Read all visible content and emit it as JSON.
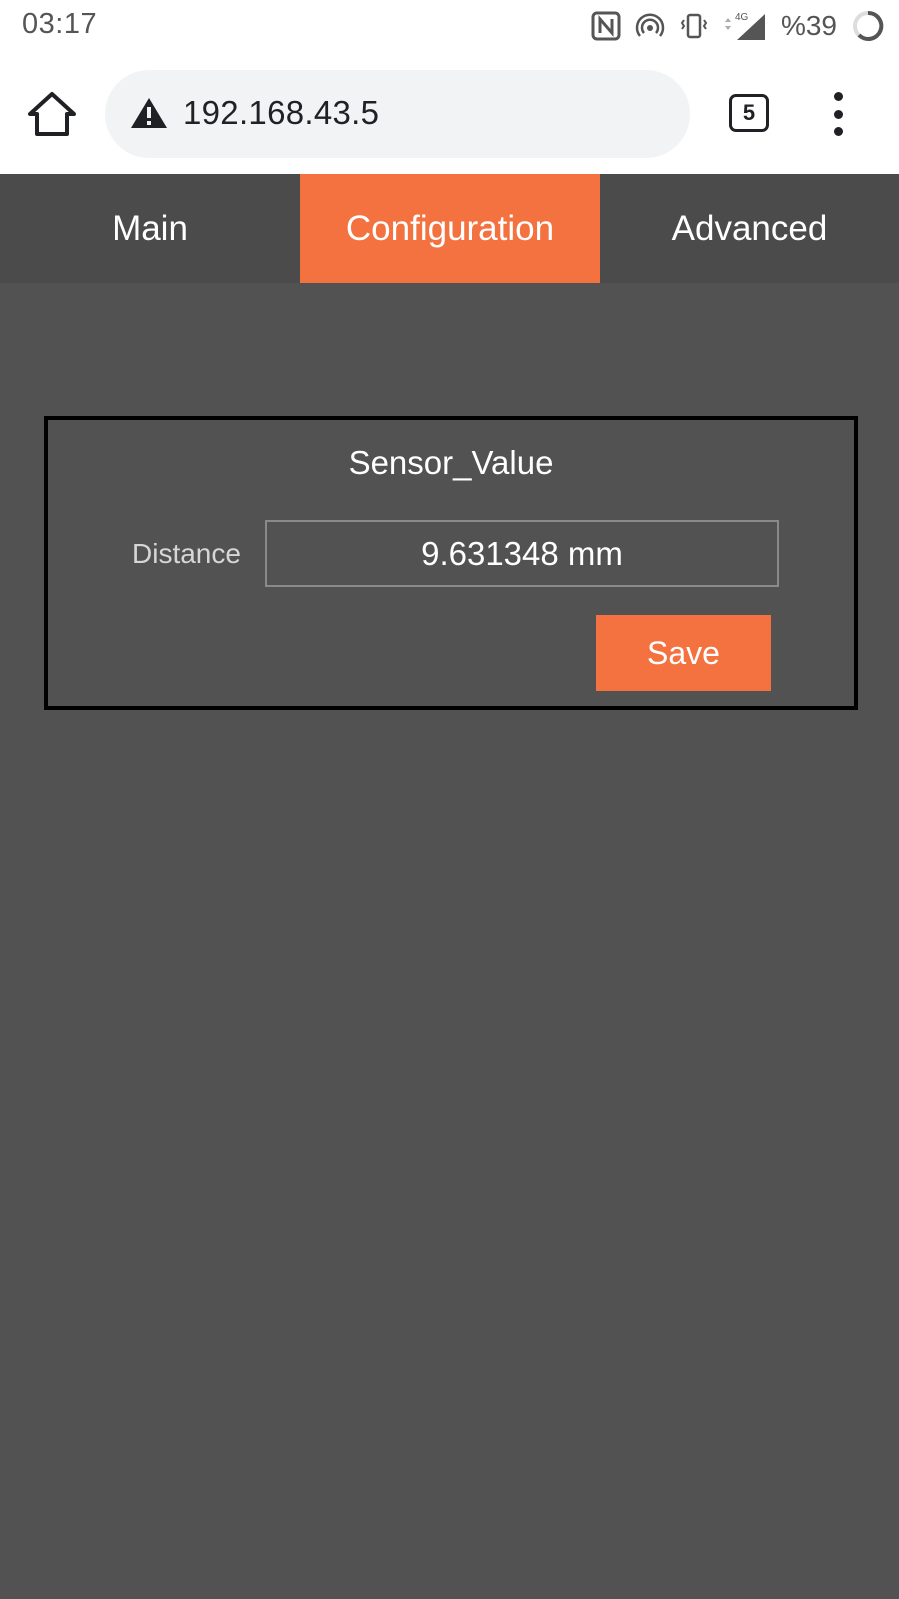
{
  "status_bar": {
    "time": "03:17",
    "battery": "%39",
    "network": "4G",
    "icons": [
      "nfc-icon",
      "hotspot-icon",
      "vibrate-icon",
      "signal-icon",
      "battery-icon"
    ]
  },
  "browser": {
    "url": "192.168.43.5",
    "tab_count": "5",
    "security_icon": "warning-icon"
  },
  "nav": {
    "tabs": [
      {
        "label": "Main",
        "active": false
      },
      {
        "label": "Configuration",
        "active": true
      },
      {
        "label": "Advanced",
        "active": false
      }
    ]
  },
  "card": {
    "title": "Sensor_Value",
    "field_label": "Distance",
    "field_value": "9.631348 mm",
    "save_label": "Save"
  },
  "colors": {
    "accent": "#f37240",
    "background": "#525252",
    "nav_background": "#4b4b4b"
  }
}
